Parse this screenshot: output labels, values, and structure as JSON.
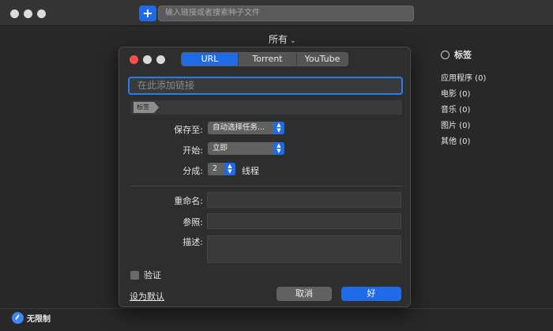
{
  "toolbar": {
    "add_label": "+",
    "search_placeholder": "输入链接或者搜索种子文件"
  },
  "filter": {
    "label": "所有",
    "chevron": "⌄"
  },
  "tags": {
    "title": "标签",
    "items": [
      "应用程序 (0)",
      "电影 (0)",
      "音乐 (0)",
      "图片 (0)",
      "其他 (0)"
    ]
  },
  "status": {
    "speed_label": "无限制"
  },
  "dialog": {
    "tabs": [
      "URL",
      "Torrent",
      "YouTube"
    ],
    "active_tab": "URL",
    "url_placeholder": "在此添加链接",
    "tag_chip": "标签",
    "save_to_label": "保存至:",
    "save_to_value": "自动选择任务...",
    "start_label": "开始:",
    "start_value": "立即",
    "split_label": "分成:",
    "split_value": "2",
    "threads_label": "线程",
    "rename_label": "重命名:",
    "referer_label": "参照:",
    "desc_label": "描述:",
    "verify_label": "验证",
    "set_default_label": "设为默认",
    "cancel_label": "取消",
    "ok_label": "好"
  },
  "colors": {
    "accent": "#1f6ae6",
    "close": "#fd4e4b",
    "background": "#282828"
  }
}
